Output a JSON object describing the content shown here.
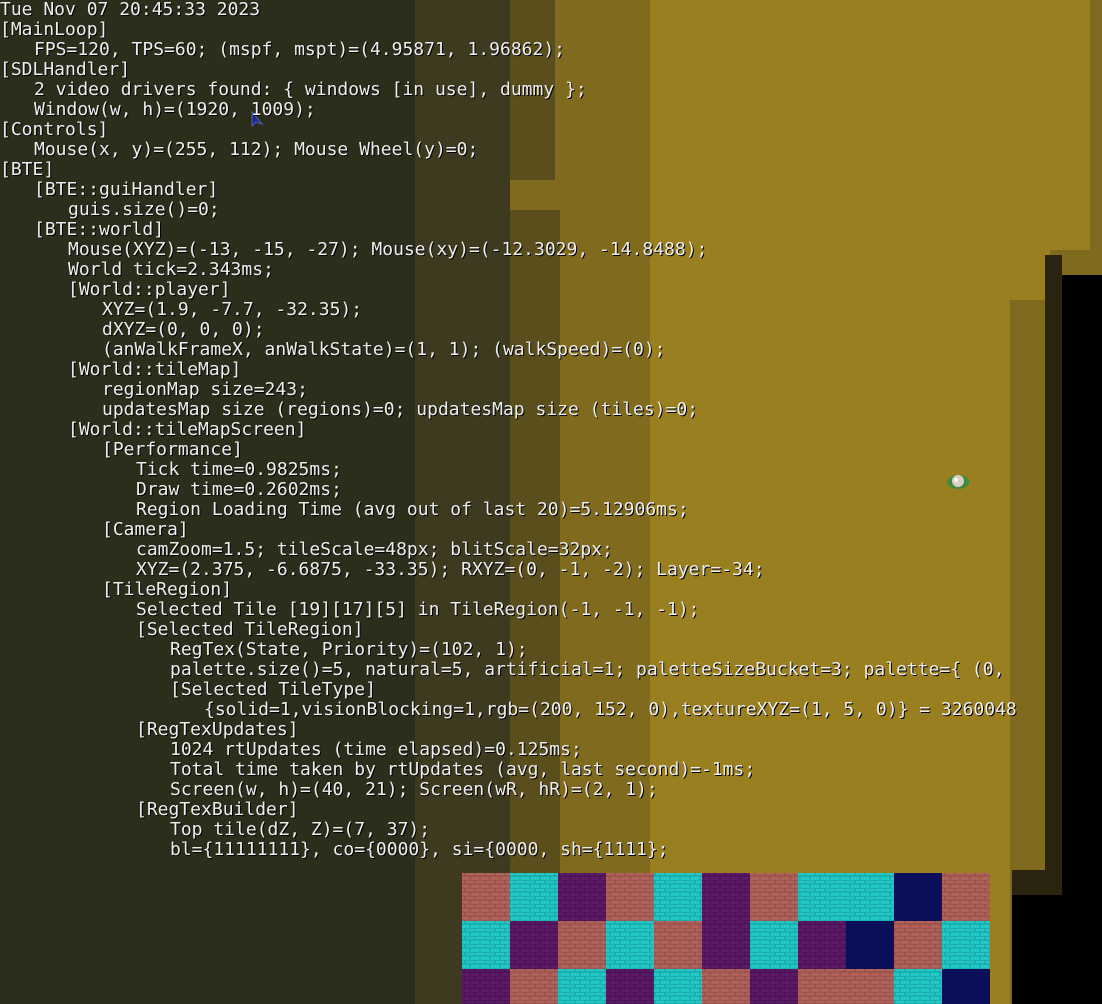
{
  "theme": {
    "background": "#262919",
    "terrain_dark": "#3a3a22",
    "terrain_mid": "#5a4f1e",
    "terrain_sand": "#8a7420",
    "terrain_bright": "#a88a22",
    "void": "#000000",
    "tile_brick_red": "#b0625a",
    "tile_cyan": "#22c8c8",
    "tile_purple": "#5a1a66",
    "tile_navy": "#0a0f5a",
    "text": "#eeeeee"
  },
  "entities": {
    "mouse_cursor": "cursor-arrow-icon",
    "player_sprite": "player-sprite-icon"
  },
  "debug_lines": [
    {
      "indent": 0,
      "text": "Tue Nov 07 20:45:33 2023"
    },
    {
      "indent": 0,
      "text": "[MainLoop]"
    },
    {
      "indent": 1,
      "text": "FPS=120, TPS=60; (mspf, mspt)=(4.95871, 1.96862);"
    },
    {
      "indent": 0,
      "text": "[SDLHandler]"
    },
    {
      "indent": 1,
      "text": "2 video drivers found: { windows [in use], dummy };"
    },
    {
      "indent": 1,
      "text": "Window(w, h)=(1920, 1009);"
    },
    {
      "indent": 0,
      "text": "[Controls]"
    },
    {
      "indent": 1,
      "text": "Mouse(x, y)=(255, 112); Mouse Wheel(y)=0;"
    },
    {
      "indent": 0,
      "text": "[BTE]"
    },
    {
      "indent": 1,
      "text": "[BTE::guiHandler]"
    },
    {
      "indent": 2,
      "text": "guis.size()=0;"
    },
    {
      "indent": 1,
      "text": "[BTE::world]"
    },
    {
      "indent": 2,
      "text": "Mouse(XYZ)=(-13, -15, -27); Mouse(xy)=(-12.3029, -14.8488);"
    },
    {
      "indent": 2,
      "text": "World tick=2.343ms;"
    },
    {
      "indent": 2,
      "text": "[World::player]"
    },
    {
      "indent": 3,
      "text": "XYZ=(1.9, -7.7, -32.35);"
    },
    {
      "indent": 3,
      "text": "dXYZ=(0, 0, 0);"
    },
    {
      "indent": 3,
      "text": "(anWalkFrameX, anWalkState)=(1, 1); (walkSpeed)=(0);"
    },
    {
      "indent": 2,
      "text": "[World::tileMap]"
    },
    {
      "indent": 3,
      "text": "regionMap size=243;"
    },
    {
      "indent": 3,
      "text": "updatesMap size (regions)=0; updatesMap size (tiles)=0;"
    },
    {
      "indent": 2,
      "text": "[World::tileMapScreen]"
    },
    {
      "indent": 3,
      "text": "[Performance]"
    },
    {
      "indent": 4,
      "text": "Tick time=0.9825ms;"
    },
    {
      "indent": 4,
      "text": "Draw time=0.2602ms;"
    },
    {
      "indent": 4,
      "text": "Region Loading Time (avg out of last 20)=5.12906ms;"
    },
    {
      "indent": 3,
      "text": "[Camera]"
    },
    {
      "indent": 4,
      "text": "camZoom=1.5; tileScale=48px; blitScale=32px;"
    },
    {
      "indent": 4,
      "text": "XYZ=(2.375, -6.6875, -33.35); RXYZ=(0, -1, -2); Layer=-34;"
    },
    {
      "indent": 3,
      "text": "[TileRegion]"
    },
    {
      "indent": 4,
      "text": "Selected Tile [19][17][5] in TileRegion(-1, -1, -1);"
    },
    {
      "indent": 4,
      "text": "[Selected TileRegion]"
    },
    {
      "indent": 5,
      "text": "RegTex(State, Priority)=(102, 1);"
    },
    {
      "indent": 5,
      "text": "palette.size()=5, natural=5, artificial=1; paletteSizeBucket=3; palette={ (0,"
    },
    {
      "indent": 5,
      "text": "[Selected TileType]"
    },
    {
      "indent": 6,
      "text": "{solid=1,visionBlocking=1,rgb=(200, 152, 0),textureXYZ=(1, 5, 0)} = 3260048"
    },
    {
      "indent": 4,
      "text": "[RegTexUpdates]"
    },
    {
      "indent": 5,
      "text": "1024 rtUpdates (time elapsed)=0.125ms;"
    },
    {
      "indent": 5,
      "text": "Total time taken by rtUpdates (avg, last second)=-1ms;"
    },
    {
      "indent": 5,
      "text": "Screen(w, h)=(40, 21); Screen(wR, hR)=(2, 1);"
    },
    {
      "indent": 4,
      "text": "[RegTexBuilder]"
    },
    {
      "indent": 5,
      "text": "Top tile(dZ, Z)=(7, 37);"
    },
    {
      "indent": 5,
      "text": "bl={11111111}, co={0000}, si={0000, sh={1111};"
    }
  ]
}
